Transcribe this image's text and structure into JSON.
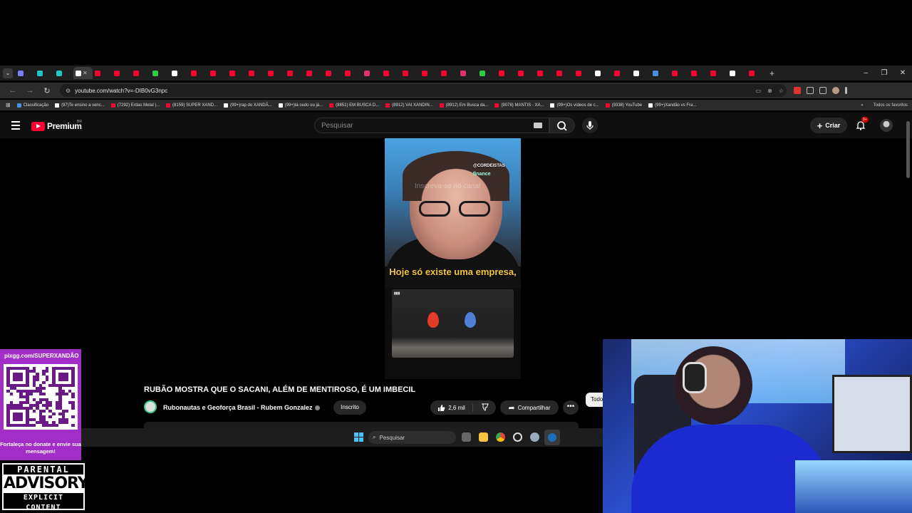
{
  "browser": {
    "url": "youtube.com/watch?v=-DIB0vG3npc",
    "tab_favicons": [
      "#7c7cff",
      "#21c7c7",
      "#21c7c7",
      "#ffffff",
      "#ff0033",
      "#ff0033",
      "#ff0033",
      "#2ecc40",
      "#ffffff",
      "#ff0033",
      "#ff0033",
      "#ff0033",
      "#ff0033",
      "#ff0033",
      "#ff0033",
      "#ff0033",
      "#ff0033",
      "#ff0033",
      "#e1306c",
      "#ff0033",
      "#ff0033",
      "#ff0033",
      "#ff0033",
      "#e1306c",
      "#2ecc40",
      "#ff0033",
      "#ff0033",
      "#ff0033",
      "#ff0033",
      "#ff0033",
      "#ffffff",
      "#ff0033",
      "#ffffff",
      "#4a90e2",
      "#ff0033",
      "#ff0033",
      "#ff0033",
      "#ffffff",
      "#ff0033"
    ],
    "bookmarks": [
      {
        "label": "Classificação",
        "color": "#4a90e2"
      },
      {
        "label": "(97)Te ensino a venc...",
        "color": "#ffffff"
      },
      {
        "label": "(7292) Erdas Metal |...",
        "color": "#ff0033"
      },
      {
        "label": "(8159) SUPER XAND...",
        "color": "#ff0033"
      },
      {
        "label": "(99+)rap do XANDÃ...",
        "color": "#ffffff"
      },
      {
        "label": "(99+)tá cedo ou já...",
        "color": "#ffffff"
      },
      {
        "label": "(8851) EM BUSCA D...",
        "color": "#ff0033"
      },
      {
        "label": "(8912) VAI XANDIN...",
        "color": "#ff0033"
      },
      {
        "label": "(8912) Em Busca da...",
        "color": "#ff0033"
      },
      {
        "label": "(9078) MANTIS - XA...",
        "color": "#ff0033"
      },
      {
        "label": "(99+)Os vídeos de c...",
        "color": "#ffffff"
      },
      {
        "label": "(9338) YouTube",
        "color": "#ff0033"
      },
      {
        "label": "(99+)Xandão vs Fra...",
        "color": "#ffffff"
      }
    ],
    "all_bookmarks": "Todos os favoritos"
  },
  "youtube": {
    "logo": "Premium",
    "region": "BR",
    "search_placeholder": "Pesquisar",
    "create_label": "Criar",
    "notif_badge": "9+"
  },
  "video": {
    "overlay_handle": "@CORDEISTAS",
    "overlay_sub": "finance",
    "overlay_faint": "Inscreva-se no canal",
    "caption": "Hoje só existe uma empresa,",
    "title": "RUBÃO MOSTRA QUE O SACANI, ALÉM DE MENTIROSO, É UM IMBECIL",
    "channel": "Rubonautas e Geoforça Brasil - Rubem Gonzalez",
    "subscribed": "Inscrito",
    "likes": "2,6 mil",
    "share": "Compartilhar",
    "chip": "Todos"
  },
  "taskbar": {
    "search_placeholder": "Pesquisar"
  },
  "overlay": {
    "url": "pixgg.com/SUPERXANDÃO",
    "message": "Fortaleça no donate e envie sua mensagem!",
    "advisory_top": "PARENTAL",
    "advisory_mid": "ADVISORY",
    "advisory_bot": "EXPLICIT CONTENT"
  }
}
